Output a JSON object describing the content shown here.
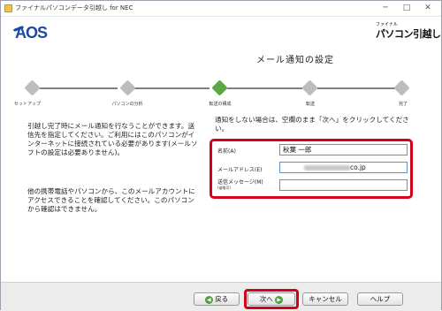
{
  "window": {
    "title": "ファイナルパソコンデータ引越し for NEC",
    "controls": {
      "minimize": "─",
      "maximize": "□",
      "close": "✕"
    }
  },
  "header": {
    "brand": "AOS",
    "product_small": "ファイナル",
    "product_main": "パソコン引越し"
  },
  "page": {
    "title": "メール通知の設定"
  },
  "steps": [
    {
      "label": "セットアップ",
      "active": false
    },
    {
      "label": "パソコンの分析",
      "active": false
    },
    {
      "label": "転送の構成",
      "active": true
    },
    {
      "label": "転送",
      "active": false
    },
    {
      "label": "完了",
      "active": false
    }
  ],
  "left_text": {
    "para1": "引越し完了時にメール通知を行なうことができます。送信先を指定してください。ご利用にはこのパソコンがインターネットに接続されている必要があります(メールソフトの設定は必要ありません)。",
    "para2": "他の携帯電話やパソコンから、このメールアカウントにアクセスできることを確認してください。このパソコンから確認はできません。"
  },
  "right_text": "通知をしない場合は、空欄のまま「次へ」をクリックしてください。",
  "form": {
    "name_label": "名前(A)",
    "name_value": "秋葉 一郎",
    "email_label": "メールアドレス(E)",
    "email_value_visible": "co.jp",
    "message_label": "送信メッセージ(M)",
    "message_sublabel": "(省略可)",
    "message_value": ""
  },
  "buttons": {
    "back": "戻る",
    "next": "次へ",
    "cancel": "キャンセル",
    "help": "ヘルプ",
    "back_icon": "left-arrow-icon",
    "next_icon": "right-arrow-icon"
  },
  "colors": {
    "brand_blue": "#1a4aa6",
    "active_step": "#5aa744",
    "highlight_red": "#d0021b"
  }
}
